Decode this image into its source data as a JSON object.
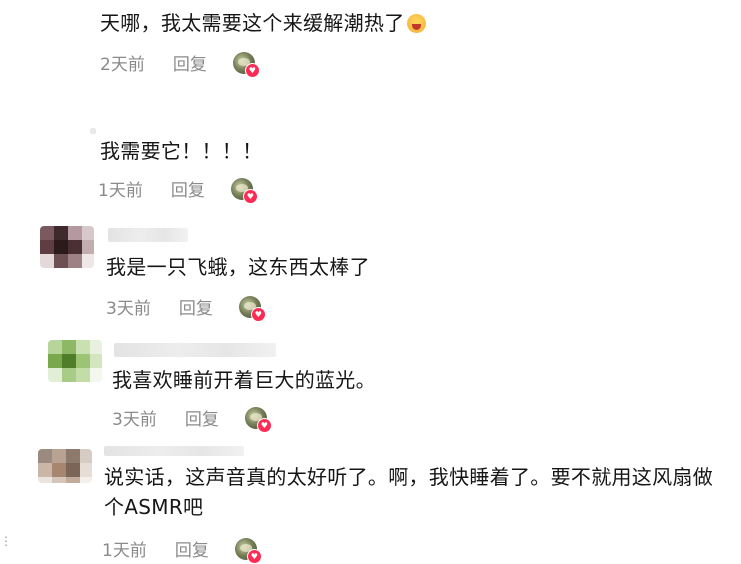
{
  "comments": [
    {
      "text": "天哪，我太需要这个来缓解潮热了",
      "emoji": "hot-face-emoji",
      "time": "2天前",
      "reply": "回复"
    },
    {
      "text": "我需要它！！！！",
      "time": "1天前",
      "reply": "回复"
    },
    {
      "text": "我是一只飞蛾，这东西太棒了",
      "time": "3天前",
      "reply": "回复"
    },
    {
      "text": "我喜欢睡前开着巨大的蓝光。",
      "time": "3天前",
      "reply": "回复"
    },
    {
      "text": "说实话，这声音真的太好听了。啊，我快睡着了。要不就用这风扇做个ASMR吧",
      "time": "1天前",
      "reply": "回复"
    }
  ],
  "colors": {
    "heart_badge": "#fe2c55",
    "meta_text": "#8a8a8a",
    "body_text": "#161616"
  }
}
